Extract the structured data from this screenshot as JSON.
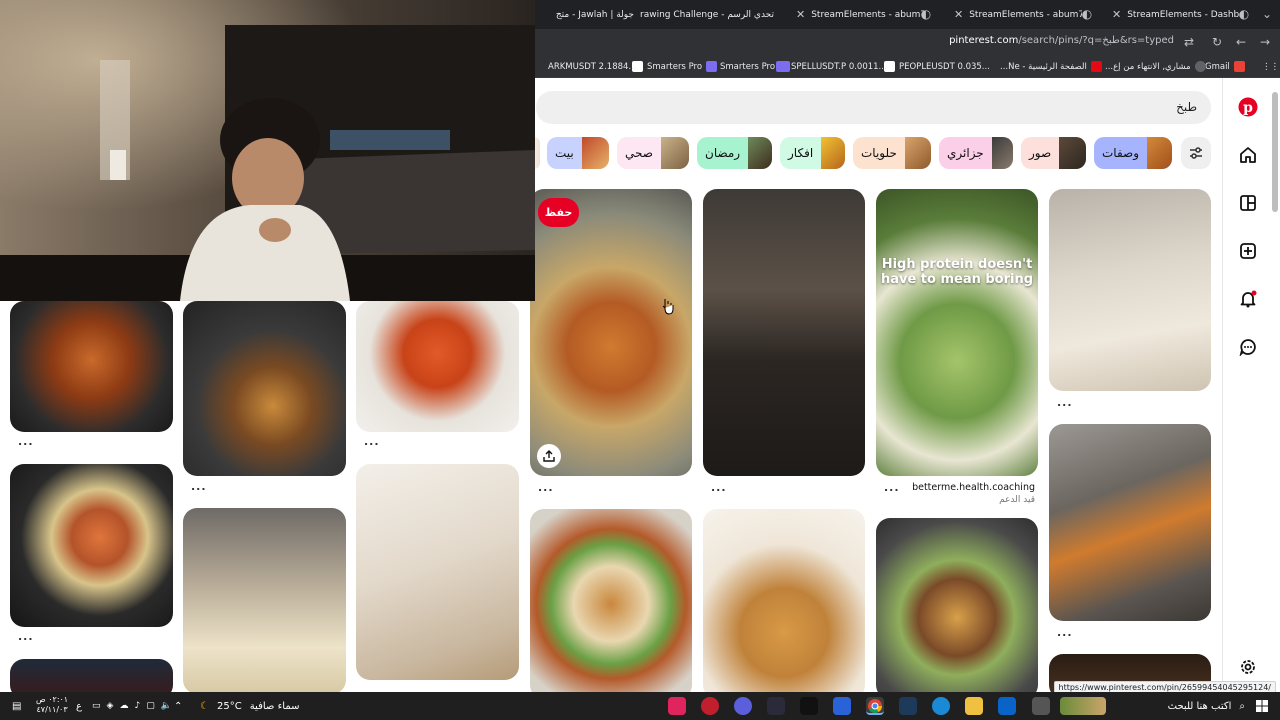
{
  "browser": {
    "tabs": [
      {
        "title": "StreamElements - Dashboard"
      },
      {
        "title": "StreamElements - abum7i"
      },
      {
        "title": "StreamElements - abum7i"
      },
      {
        "title": "تحدي الرسم - Drawing Challenge"
      },
      {
        "title": "جولة | Jawlah - متج"
      }
    ],
    "url_prefix": "pinterest.com",
    "url_path": "/search/pins/?q=طبخ&rs=typed",
    "bookmarks": [
      {
        "label": "Gmail"
      },
      {
        "label": "مشاري, الانتهاء من إع..."
      },
      {
        "label": "الصفحة الرئيسية - Ne..."
      },
      {
        "label": "PEOPLEUSDT 0.035..."
      },
      {
        "label": "SPELLUSDT.P 0.0011..."
      },
      {
        "label": "Smarters Pro"
      },
      {
        "label": "Smarters Pro"
      },
      {
        "label": "ARKMUSDT 2.1884..."
      }
    ]
  },
  "search": {
    "value": "طبخ"
  },
  "chips": [
    {
      "label": "وصفات",
      "color": "#a5b4fc"
    },
    {
      "label": "صور",
      "color": "#fde0dc"
    },
    {
      "label": "جزائري",
      "color": "#fbcfe8"
    },
    {
      "label": "حلويات",
      "color": "#fde2cf"
    },
    {
      "label": "افكار",
      "color": "#d1fae5"
    },
    {
      "label": "رمضان",
      "color": "#a7f3d0"
    },
    {
      "label": "صحي",
      "color": "#fce7f3"
    },
    {
      "label": "بيت",
      "color": "#c7d2fe"
    }
  ],
  "pins": {
    "save_label": "حفظ",
    "more_label": "...",
    "protein_text_1": "High protein doesn't",
    "protein_text_2": "have to mean",
    "protein_text_bold": "boring",
    "protein_credit": "betterme.health.coaching",
    "protein_subcredit": "قيد الدعم"
  },
  "taskbar": {
    "search_placeholder": "اكتب هنا للبحث",
    "weather_text": "سماء صافية",
    "temperature": "25°C",
    "time": "٠٢:٠١ ص",
    "date": "٤٧/١١/٠٣",
    "lang": "ع"
  },
  "status_url": "https://www.pinterest.com/pin/26599454045295124/"
}
